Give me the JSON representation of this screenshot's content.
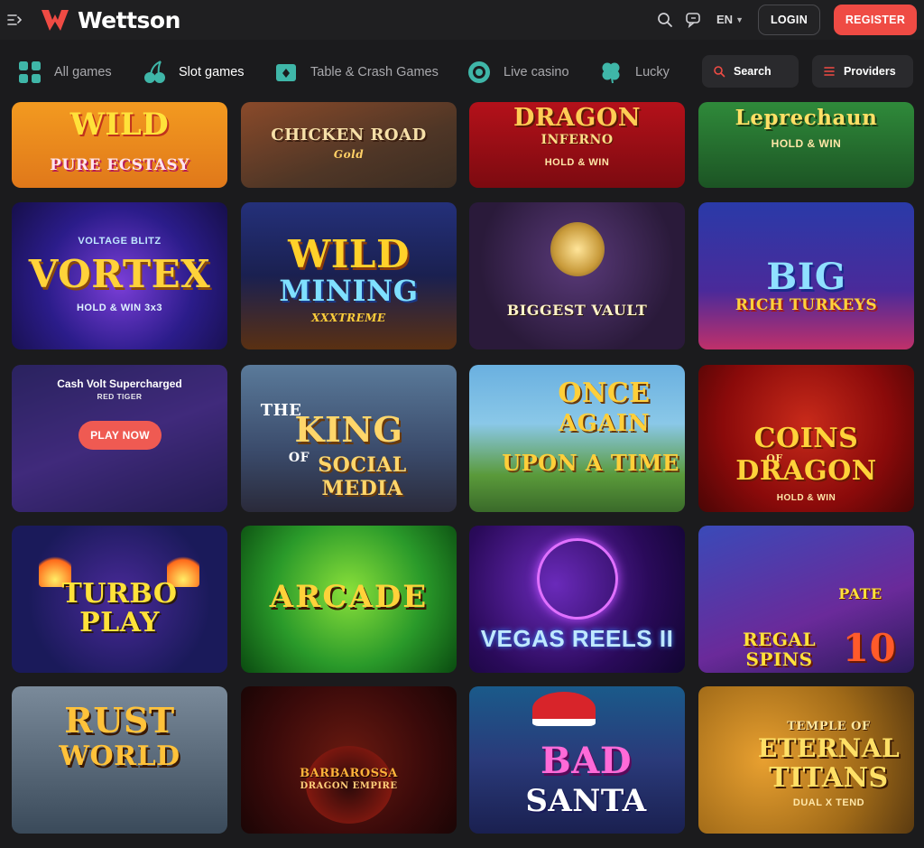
{
  "brand": {
    "name": "Wettson",
    "accent": "#ef4b44"
  },
  "header": {
    "icons": [
      "menu-toggle-icon",
      "search-icon",
      "chat-icon"
    ],
    "language": "EN",
    "login_label": "LOGIN",
    "register_label": "REGISTER"
  },
  "nav": {
    "categories": [
      {
        "label": "All games",
        "icon": "grid-icon",
        "active": false
      },
      {
        "label": "Slot games",
        "icon": "cherry-icon",
        "active": true
      },
      {
        "label": "Table & Crash Games",
        "icon": "cards-icon",
        "active": false
      },
      {
        "label": "Live casino",
        "icon": "chip-icon",
        "active": false
      },
      {
        "label": "Lucky",
        "icon": "clover-icon",
        "active": false
      }
    ],
    "search_label": "Search",
    "providers_label": "Providers"
  },
  "games": [
    {
      "lines": [
        "WILD",
        "PURE ECSTASY"
      ]
    },
    {
      "lines": [
        "CHICKEN ROAD",
        "Gold"
      ]
    },
    {
      "lines": [
        "DRAGON",
        "INFERNO",
        "HOLD & WIN"
      ]
    },
    {
      "lines": [
        "Leprechaun",
        "HOLD & WIN"
      ]
    },
    {
      "lines": [
        "VOLTAGE BLITZ",
        "VORTEX",
        "HOLD & WIN 3x3"
      ]
    },
    {
      "lines": [
        "WILD",
        "MINING",
        "XXXTREME"
      ]
    },
    {
      "lines": [
        "BIGGEST VAULT"
      ]
    },
    {
      "lines": [
        "BIG",
        "RICH TURKEYS"
      ]
    },
    {
      "lines": [
        "Cash Volt Supercharged",
        "RED TIGER",
        "PLAY NOW"
      ],
      "hovered": true
    },
    {
      "lines": [
        "THE",
        "KING",
        "OF",
        "SOCIAL",
        "MEDIA"
      ]
    },
    {
      "lines": [
        "ONCE",
        "AGAIN",
        "UPON A TIME"
      ]
    },
    {
      "lines": [
        "COINS",
        "OF",
        "DRAGON",
        "HOLD & WIN"
      ]
    },
    {
      "lines": [
        "TURBO",
        "PLAY"
      ]
    },
    {
      "lines": [
        "ARCADE"
      ]
    },
    {
      "lines": [
        "VEGAS REELS II"
      ]
    },
    {
      "lines": [
        "PATE",
        "REGAL",
        "SPINS",
        "10"
      ]
    },
    {
      "lines": [
        "RUST",
        "WORLD"
      ]
    },
    {
      "lines": [
        "BARBAROSSA",
        "DRAGON EMPIRE"
      ]
    },
    {
      "lines": [
        "BAD",
        "SANTA"
      ]
    },
    {
      "lines": [
        "TEMPLE OF",
        "ETERNAL",
        "TITANS",
        "DUAL X TEND"
      ]
    }
  ]
}
